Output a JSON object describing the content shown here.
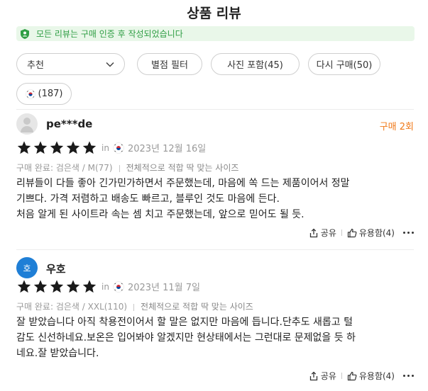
{
  "page": {
    "title": "상품 리뷰"
  },
  "notice": {
    "text": "모든 리뷰는 구매 인증 후 작성되었습니다",
    "icon": "shield-check-icon",
    "color": "#2f9e44",
    "bg": "#e9f7e9"
  },
  "filters": {
    "sort": {
      "label": "추천",
      "icon": "chevron-down-icon"
    },
    "rating": "별점 필터",
    "photo": "사진 포함(45)",
    "repurchase": "다시 구매(50)",
    "country": "(187)",
    "country_icon": "korea-flag-icon"
  },
  "reviews": [
    {
      "username": "pe***de",
      "avatar": "default-avatar-icon",
      "order_count": "구매 2회",
      "rating": 5,
      "in": "in",
      "date": "2023년 12월 16일",
      "purchase": "구매 완료: 검은색 / M(77)",
      "fit": "전체적으로 적합 딱 맞는 사이즈",
      "lines": [
        "리뷰들이 다들 좋아 긴가민가하면서 주문했는데, 마음에 쏙 드는 제품이어서 정말",
        "기쁘다. 가격 저렴하고 배송도 빠르고, 블루인 것도 마음에 든다.",
        "처음 알게 된 사이트라 속는 셈 치고 주문했는데, 앞으로 믿어도 될 듯."
      ],
      "share": "공유",
      "helpful": "유용함(4)"
    },
    {
      "username": "우호",
      "avatar_initial": "호",
      "rating": 5,
      "in": "in",
      "date": "2023년 11월 7일",
      "purchase": "구매 완료: 검은색 / XXL(110)",
      "fit": "전체적으로 적합 딱 맞는 사이즈",
      "lines": [
        "잘 받았습니다 아직 착용전이어서 할 말은 없지만 마음에 듭니다.단추도 새롭고 털",
        "감도 신선하네요.보온은 입어봐야 알겠지만 현상태에서는 그런대로 문제없을 듯 하",
        "네요.잘 받았습니다."
      ],
      "share": "공유",
      "helpful": "유용함(4)"
    }
  ],
  "colors": {
    "accent_orange": "#f07a1a",
    "avatar_blue": "#1f7fd6",
    "star": "#1a1a1a"
  }
}
